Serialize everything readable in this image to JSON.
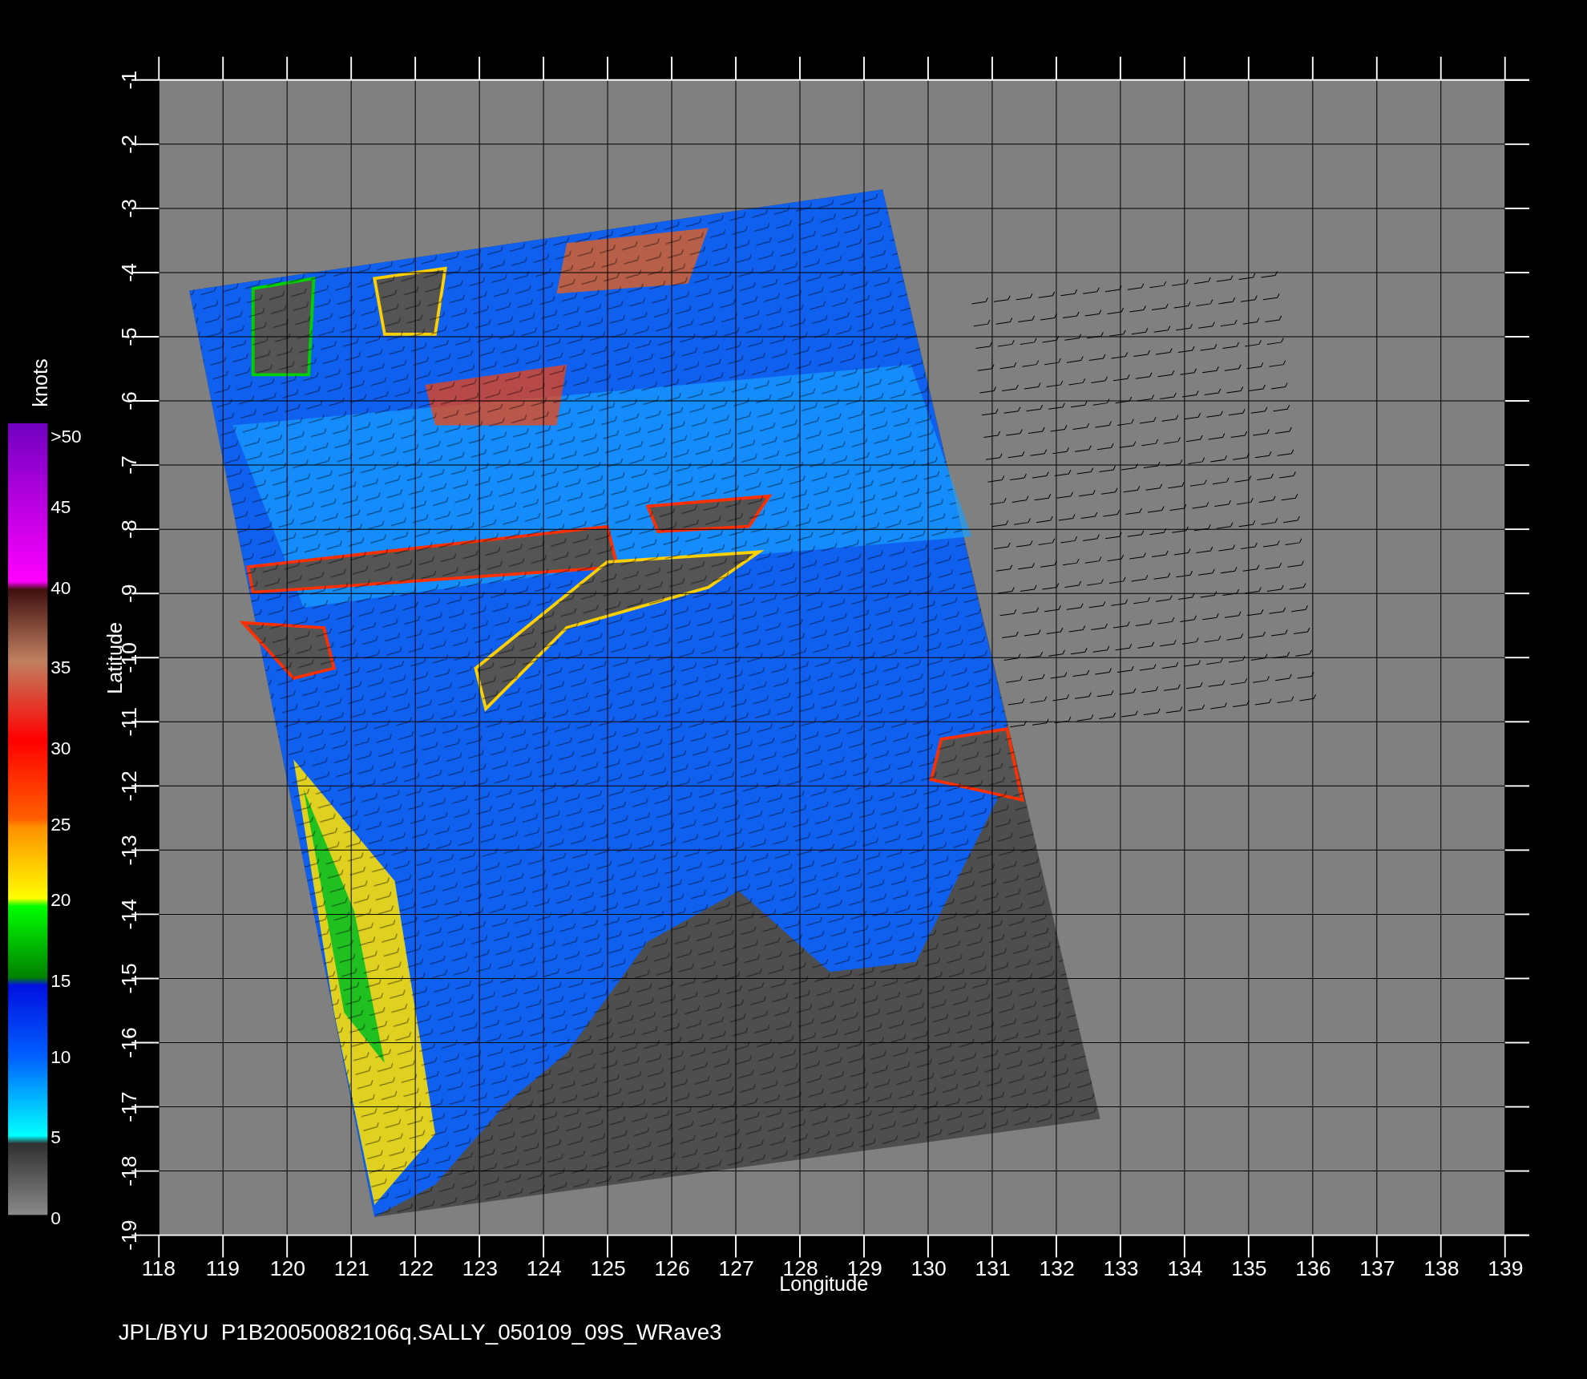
{
  "plot": {
    "ylabel": "Latitude",
    "xlabel": "Longitude",
    "yticks": [
      "-1",
      "-2",
      "-3",
      "-4",
      "-5",
      "-6",
      "-7",
      "-8",
      "-9",
      "-10",
      "-11",
      "-12",
      "-13",
      "-14",
      "-15",
      "-16",
      "-17",
      "-18",
      "-19"
    ],
    "xticks": [
      "118",
      "119",
      "120",
      "121",
      "122",
      "123",
      "124",
      "125",
      "126",
      "127",
      "128",
      "129",
      "130",
      "131",
      "132",
      "133",
      "134",
      "135",
      "136",
      "137",
      "138",
      "139"
    ]
  },
  "colorbar": {
    "unit": "knots",
    "labels": [
      ">50",
      "45",
      "40",
      "35",
      "30",
      "25",
      "20",
      "15",
      "10",
      "5",
      "0"
    ]
  },
  "caption": "JPL/BYU  P1B20050082106q.SALLY_050109_09S_WRave3"
}
